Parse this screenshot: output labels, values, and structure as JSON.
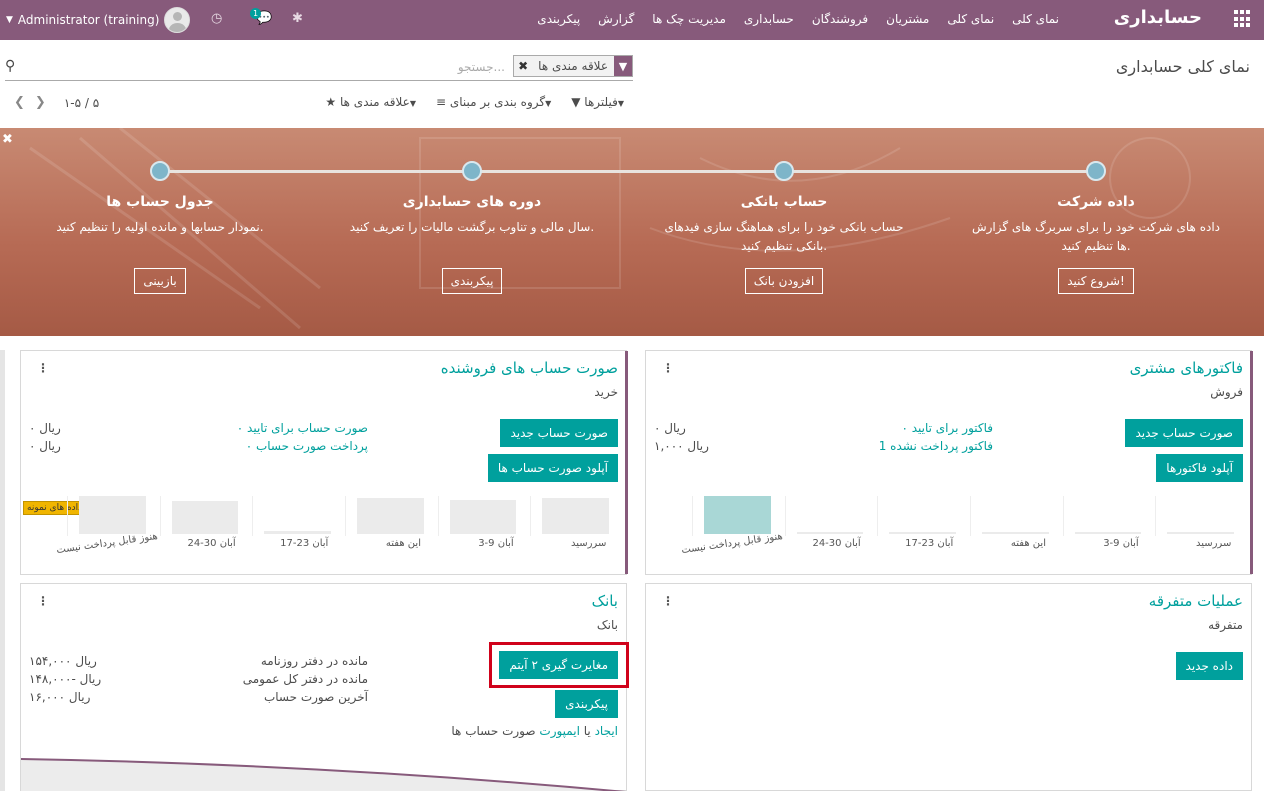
{
  "navbar": {
    "brand": "حسابداری",
    "menu": [
      "نمای کلی",
      "نمای کلی",
      "مشتریان",
      "فروشندگان",
      "حسابداری",
      "مدیریت چک ها",
      "گزارش",
      "پیکربندی"
    ],
    "user": "Administrator (training)",
    "chat_badge": "1"
  },
  "control": {
    "breadcrumb": "نمای کلی حسابداری",
    "facet_label": "علاقه مندی ها",
    "search_placeholder": "جستجو...",
    "filters": "فیلترها",
    "group_by": "گروه بندی بر مبنای",
    "favorites": "علاقه مندی ها",
    "pager_value": "۱-۵ / ۵"
  },
  "banner": {
    "steps": [
      {
        "title": "داده شرکت",
        "desc": "داده های شرکت خود را برای سربرگ های گزارش ها تنظیم کنید.",
        "button": "شروع کنید!"
      },
      {
        "title": "حساب بانکی",
        "desc": "حساب بانکی خود را برای هماهنگ سازی فیدهای بانکی تنظیم کنید.",
        "button": "افزودن بانک"
      },
      {
        "title": "دوره های حسابداری",
        "desc": "سال مالی و تناوب برگشت مالیات را تعریف کنید.",
        "button": "پیکربندی"
      },
      {
        "title": "جدول حساب ها",
        "desc": "نمودار حسابها و مانده اولیه را تنظیم کنید.",
        "button": "بازبینی"
      }
    ]
  },
  "cards": {
    "customer_invoices": {
      "title": "فاکتورهای مشتری",
      "subtitle": "فروش",
      "btn_new": "صورت حساب جدید",
      "btn_upload": "آپلود فاکتورها",
      "rows": [
        {
          "label": "۰ فاکتور برای تایید",
          "value": "۰ ریال"
        },
        {
          "label": "1 فاکتور پرداخت نشده",
          "value": "۱,۰۰۰ ریال"
        }
      ],
      "xlabels": [
        "سررسید",
        "3-9 آبان",
        "این هفته",
        "17-23 آبان",
        "24-30 آبان",
        "هنوز قابل پرداخت نیست"
      ]
    },
    "vendor_bills": {
      "title": "صورت حساب های فروشنده",
      "subtitle": "خرید",
      "btn_new": "صورت حساب جدید",
      "btn_upload": "آپلود صورت حساب ها",
      "sample_badge": "داده های نمونه",
      "rows": [
        {
          "label": "۰ صورت حساب برای تایید",
          "value": "۰ ریال"
        },
        {
          "label": "۰ پرداخت صورت حساب",
          "value": "۰ ریال"
        }
      ],
      "xlabels": [
        "سررسید",
        "3-9 آبان",
        "این هفته",
        "17-23 آبان",
        "24-30 آبان",
        "هنوز قابل پرداخت نیست"
      ]
    },
    "misc": {
      "title": "عملیات متفرقه",
      "subtitle": "متفرقه",
      "btn_new": "داده جدید"
    },
    "bank": {
      "title": "بانک",
      "subtitle": "بانک",
      "btn_reconcile": "مغایرت گیری ۲ آیتم",
      "btn_config": "پیکربندی",
      "create_link": "ایجاد",
      "or_text": "یا",
      "import_link": "ایمپورت",
      "statements_text": "صورت حساب ها",
      "rows": [
        {
          "label": "مانده در دفتر روزنامه",
          "value": "۱۵۴,۰۰۰ ریال"
        },
        {
          "label": "مانده در دفتر کل عمومی",
          "value": "۱۴۸,۰۰۰- ریال"
        },
        {
          "label": "آخرین صورت حساب",
          "value": "۱۶,۰۰۰ ریال"
        }
      ]
    }
  },
  "chart_data": [
    {
      "type": "bar",
      "categories": [
        "سررسید",
        "3-9 آبان",
        "این هفته",
        "17-23 آبان",
        "24-30 آبان",
        "هنوز قابل پرداخت نیست"
      ],
      "values": [
        0,
        0,
        0,
        0,
        0,
        1000
      ]
    },
    {
      "type": "bar",
      "categories": [
        "سررسید",
        "3-9 آبان",
        "این هفته",
        "17-23 آبان",
        "24-30 آبان",
        "هنوز قابل پرداخت نیست"
      ],
      "values": [
        34,
        32,
        34,
        3,
        31,
        36
      ]
    }
  ],
  "colors": {
    "brand": "#875a7b",
    "accent": "#00a09d",
    "highlight": "#d0021b"
  }
}
